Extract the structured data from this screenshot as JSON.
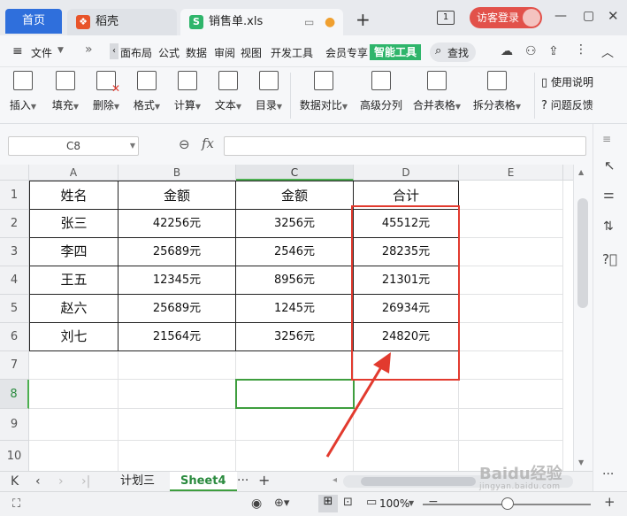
{
  "titlebar": {
    "home_tab": "首页",
    "app_tab": "稻壳",
    "file_tab": "销售单.xls",
    "file_tab_icon": "S",
    "new_tab": "+",
    "badge": "1",
    "login": "访客登录"
  },
  "menubar": {
    "file": "文件",
    "items": [
      "面布局",
      "公式",
      "数据",
      "审阅",
      "视图",
      "开发工具",
      "会员专享"
    ],
    "highlight": "智能工具",
    "search": "查找"
  },
  "ribbon": {
    "buttons": [
      {
        "label": "插入",
        "icon": "insert-icon"
      },
      {
        "label": "填充",
        "icon": "fill-icon"
      },
      {
        "label": "删除",
        "icon": "delete-icon"
      },
      {
        "label": "格式",
        "icon": "format-icon"
      },
      {
        "label": "计算",
        "icon": "calculate-icon"
      },
      {
        "label": "文本",
        "icon": "text-icon"
      },
      {
        "label": "目录",
        "icon": "toc-icon"
      },
      {
        "label": "数据对比",
        "icon": "compare-icon"
      },
      {
        "label": "高级分列",
        "icon": "split-column-icon"
      },
      {
        "label": "合并表格",
        "icon": "merge-table-icon"
      },
      {
        "label": "拆分表格",
        "icon": "split-table-icon"
      }
    ],
    "help": "使用说明",
    "feedback": "问题反馈"
  },
  "formula": {
    "cell_ref": "C8",
    "fx": "fx",
    "value": ""
  },
  "grid": {
    "columns": [
      "A",
      "B",
      "C",
      "D",
      "E"
    ],
    "rows": [
      "1",
      "2",
      "3",
      "4",
      "5",
      "6",
      "7",
      "8",
      "9",
      "10"
    ],
    "header_row": [
      "姓名",
      "金额",
      "金额",
      "合计"
    ],
    "data": [
      [
        "张三",
        "42256元",
        "3256元",
        "45512元"
      ],
      [
        "李四",
        "25689元",
        "2546元",
        "28235元"
      ],
      [
        "王五",
        "12345元",
        "8956元",
        "21301元"
      ],
      [
        "赵六",
        "25689元",
        "1245元",
        "26934元"
      ],
      [
        "刘七",
        "21564元",
        "3256元",
        "24820元"
      ]
    ],
    "selected_cell": "C8"
  },
  "sheets": {
    "tabs": [
      "计划三",
      "Sheet4"
    ],
    "active": "Sheet4",
    "more": "···",
    "add": "+"
  },
  "statusbar": {
    "zoom": "100%",
    "minus": "−",
    "plus": "+"
  },
  "watermark": {
    "text": "Baidu经验",
    "sub": "jingyan.baidu.com"
  },
  "colors": {
    "accent_blue": "#2f6fdc",
    "accent_green": "#2fb56b",
    "annotation_red": "#e23a2e",
    "login_red": "#e2514a"
  }
}
